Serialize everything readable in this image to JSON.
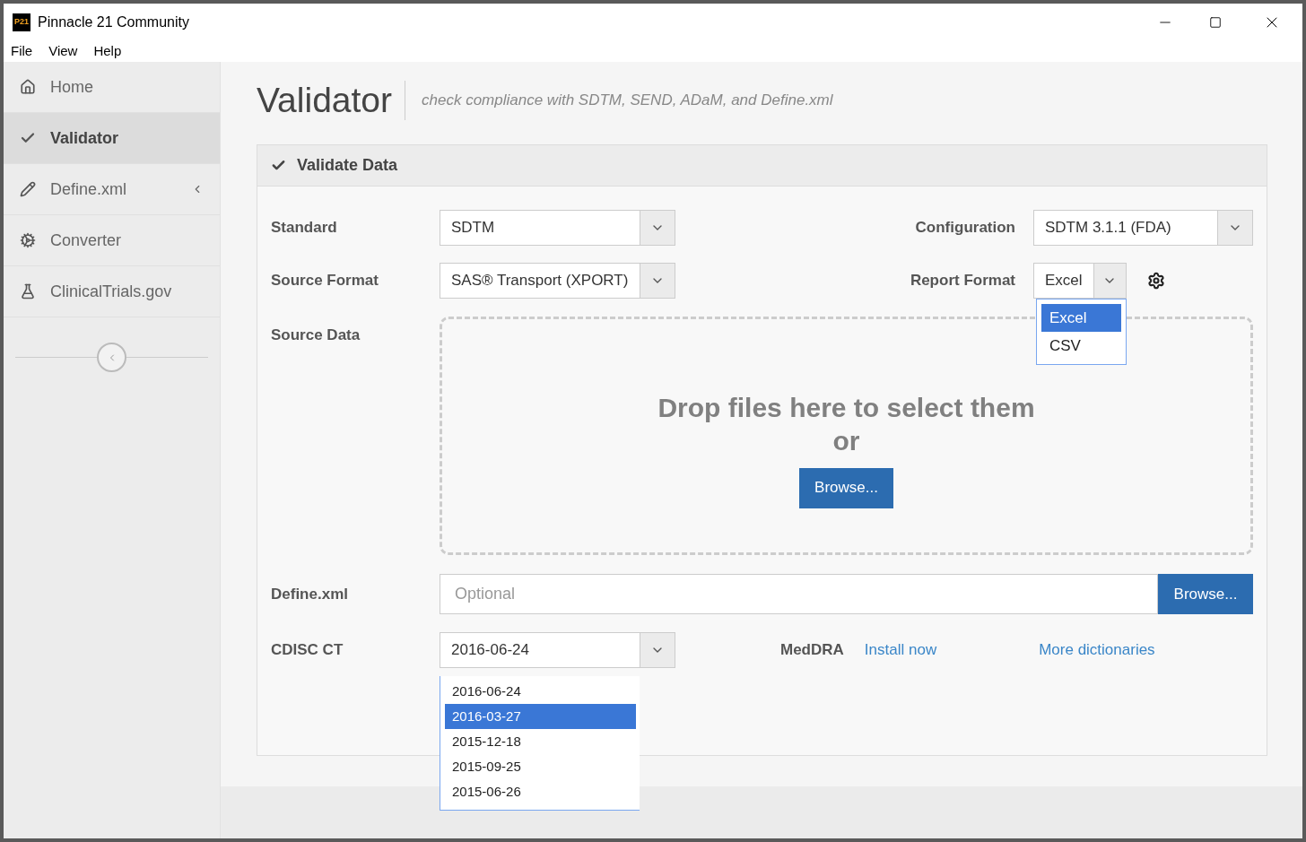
{
  "window": {
    "logo_text": "P21",
    "title": "Pinnacle 21 Community"
  },
  "menu": [
    "File",
    "View",
    "Help"
  ],
  "sidebar": {
    "items": [
      {
        "label": "Home",
        "kind": "home",
        "selected": false,
        "has_submenu": false
      },
      {
        "label": "Validator",
        "kind": "check",
        "selected": true,
        "has_submenu": false
      },
      {
        "label": "Define.xml",
        "kind": "pencil",
        "selected": false,
        "has_submenu": true
      },
      {
        "label": "Converter",
        "kind": "gears",
        "selected": false,
        "has_submenu": false
      },
      {
        "label": "ClinicalTrials.gov",
        "kind": "flask",
        "selected": false,
        "has_submenu": false
      }
    ]
  },
  "page": {
    "title": "Validator",
    "subtitle": "check compliance with SDTM, SEND, ADaM, and Define.xml"
  },
  "panel": {
    "title": "Validate Data",
    "standard": {
      "label": "Standard",
      "value": "SDTM"
    },
    "configuration": {
      "label": "Configuration",
      "value": "SDTM 3.1.1 (FDA)"
    },
    "source_format": {
      "label": "Source Format",
      "value": "SAS® Transport (XPORT)"
    },
    "report_format": {
      "label": "Report Format",
      "value": "Excel",
      "options": [
        {
          "label": "Excel",
          "selected": true
        },
        {
          "label": "CSV",
          "selected": false
        }
      ]
    },
    "source_data": {
      "label": "Source Data",
      "drop_text": "Drop files here to select them",
      "or_text": "or",
      "button": "Browse..."
    },
    "define_xml": {
      "label": "Define.xml",
      "placeholder": "Optional",
      "button": "Browse..."
    },
    "cdisc_ct": {
      "label": "CDISC CT",
      "value": "2016-06-24",
      "options": [
        {
          "label": "2016-06-24",
          "highlighted": false
        },
        {
          "label": "2016-03-27",
          "highlighted": true
        },
        {
          "label": "2015-12-18",
          "highlighted": false
        },
        {
          "label": "2015-09-25",
          "highlighted": false
        },
        {
          "label": "2015-06-26",
          "highlighted": false
        }
      ]
    },
    "meddra": {
      "label": "MedDRA",
      "link": "Install now"
    },
    "more_dictionaries": "More dictionaries"
  }
}
